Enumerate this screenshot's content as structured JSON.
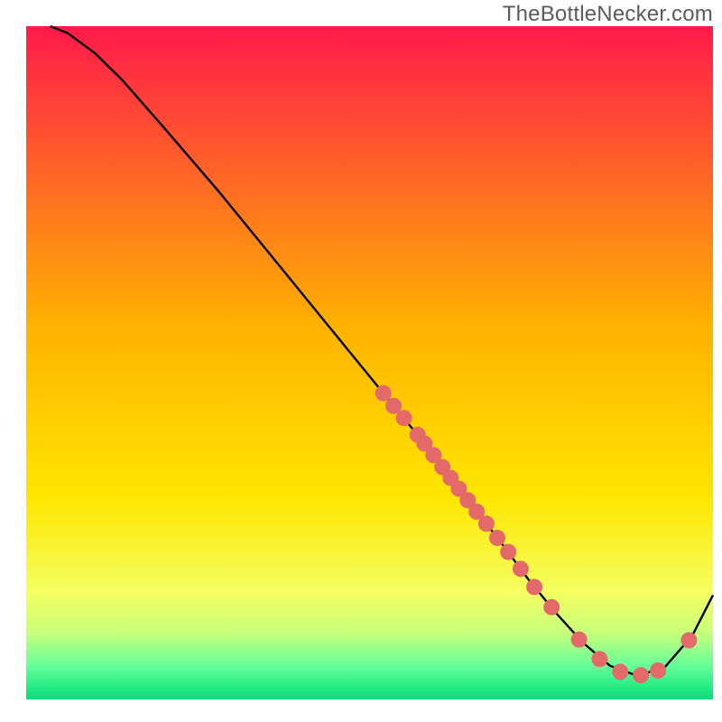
{
  "watermark": "TheBottleNecker.com",
  "chart_data": {
    "type": "line",
    "title": "",
    "xlabel": "",
    "ylabel": "",
    "xlim": [
      0,
      100
    ],
    "ylim": [
      0,
      100
    ],
    "gradient_stops": [
      {
        "offset": 0,
        "color": "#ff1a4b"
      },
      {
        "offset": 0.45,
        "color": "#ffb300"
      },
      {
        "offset": 0.7,
        "color": "#ffe600"
      },
      {
        "offset": 0.84,
        "color": "#f4ff62"
      },
      {
        "offset": 0.9,
        "color": "#c9ff7a"
      },
      {
        "offset": 0.95,
        "color": "#66ff99"
      },
      {
        "offset": 1.0,
        "color": "#00e07a"
      }
    ],
    "series": [
      {
        "name": "bottleneck-curve",
        "color": "#000000",
        "x": [
          3.5,
          6.0,
          10.0,
          14.0,
          20.0,
          28.0,
          36.0,
          44.0,
          52.0,
          58.0,
          64.0,
          69.0,
          73.0,
          77.0,
          81.0,
          85.0,
          89.0,
          93.0,
          97.0,
          100.0
        ],
        "y": [
          100.0,
          99.0,
          96.0,
          92.0,
          85.0,
          75.5,
          65.5,
          55.5,
          45.5,
          38.0,
          30.0,
          23.5,
          18.0,
          13.0,
          8.5,
          5.0,
          3.5,
          4.8,
          9.5,
          15.5
        ]
      }
    ],
    "markers": [
      {
        "name": "curve-points",
        "color": "#e46a6a",
        "radius": 9,
        "points": [
          {
            "x": 52.0,
            "y": 45.5
          },
          {
            "x": 53.5,
            "y": 43.6
          },
          {
            "x": 55.0,
            "y": 41.8
          },
          {
            "x": 57.0,
            "y": 39.3
          },
          {
            "x": 58.0,
            "y": 38.0
          },
          {
            "x": 59.3,
            "y": 36.3
          },
          {
            "x": 60.6,
            "y": 34.5
          },
          {
            "x": 61.8,
            "y": 32.9
          },
          {
            "x": 63.0,
            "y": 31.3
          },
          {
            "x": 64.3,
            "y": 29.6
          },
          {
            "x": 65.6,
            "y": 27.9
          },
          {
            "x": 67.0,
            "y": 26.1
          },
          {
            "x": 68.6,
            "y": 24.0
          },
          {
            "x": 70.2,
            "y": 21.9
          },
          {
            "x": 72.0,
            "y": 19.4
          },
          {
            "x": 74.0,
            "y": 16.7
          },
          {
            "x": 76.5,
            "y": 13.7
          },
          {
            "x": 80.5,
            "y": 8.9
          },
          {
            "x": 83.5,
            "y": 6.0
          },
          {
            "x": 86.5,
            "y": 4.1
          },
          {
            "x": 89.5,
            "y": 3.6
          },
          {
            "x": 92.0,
            "y": 4.3
          },
          {
            "x": 96.5,
            "y": 8.8
          }
        ]
      }
    ]
  }
}
